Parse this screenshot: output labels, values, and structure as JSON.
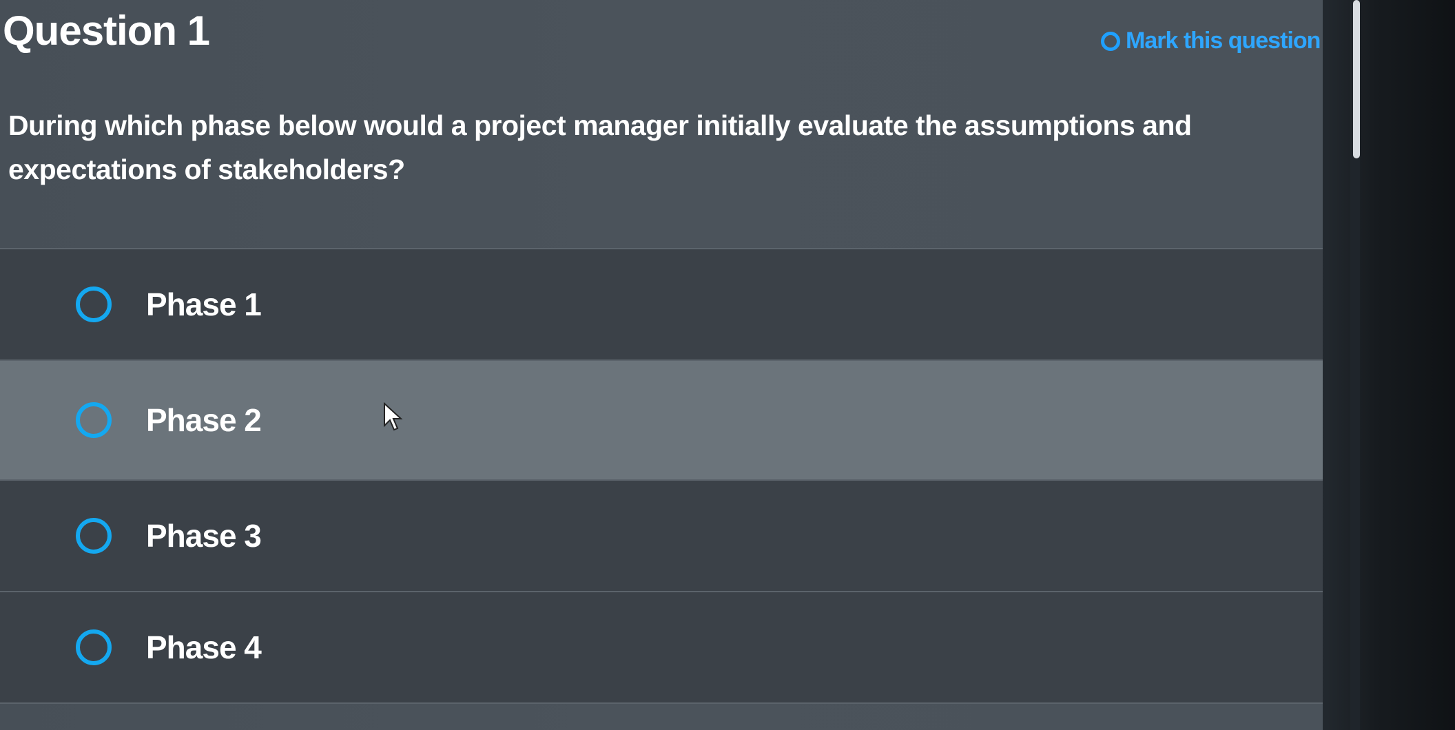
{
  "question": {
    "title": "Question 1",
    "mark_label": "Mark this question",
    "prompt": "During which phase below would a project manager initially evaluate the assumptions and expectations of stakeholders?"
  },
  "options": [
    {
      "label": "Phase 1"
    },
    {
      "label": "Phase 2"
    },
    {
      "label": "Phase 3"
    },
    {
      "label": "Phase 4"
    }
  ],
  "icons": {
    "radio": "radio-empty-icon",
    "mark": "radio-empty-icon",
    "cursor": "mouse-cursor-icon"
  },
  "colors": {
    "accent": "#1fa0ff",
    "background": "#4a525a",
    "option_background": "#3b4148",
    "hovered_option_background": "#6b747b"
  }
}
